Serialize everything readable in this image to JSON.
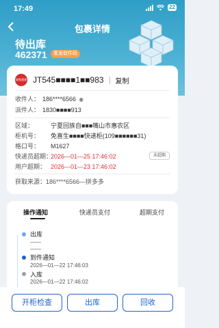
{
  "statusbar": {
    "time": "17:49",
    "battery": "22"
  },
  "nav": {
    "title": "包裹详情"
  },
  "package": {
    "status": "待出库",
    "code": "462371",
    "badge": "重发取件码"
  },
  "courier": {
    "logo_text": "极兔速递",
    "tracking": "JT545■■■■1■■983",
    "copy_label": "复制"
  },
  "info": {
    "recipient_label": "收件人：",
    "recipient_phone": "186****6566",
    "sender_label": "派件人：",
    "sender_phone": "1830■■■■913",
    "region_label": "区域：",
    "region": "宁夏回族自■■■嘴山市惠农区",
    "cabinet_label": "柜机号：",
    "cabinet": "免喜生■■■■快递柜(109■■■■■■31)",
    "slot_label": "格口号：",
    "slot": "M1627",
    "courier_overdue_label": "快递员超期：",
    "courier_overdue": "2026—01—25 17:46:02",
    "overdue_pill": "未超期",
    "user_overdue_label": "用户超期：",
    "user_overdue": "2026—01—23 17:46:02",
    "source": "获取来源：186****6566—拼多多"
  },
  "tabs": [
    "操作通知",
    "快递员支付",
    "超期支付"
  ],
  "timeline": [
    {
      "title": "出库",
      "line1": "——",
      "line2": "——"
    },
    {
      "title": "到件通知",
      "time": "2026—01—22 17:46:03"
    },
    {
      "title": "入库",
      "time": "2026—01—22 17:46:02"
    }
  ],
  "actions": {
    "open": "开柜检查",
    "out": "出库",
    "recycle": "回收"
  }
}
